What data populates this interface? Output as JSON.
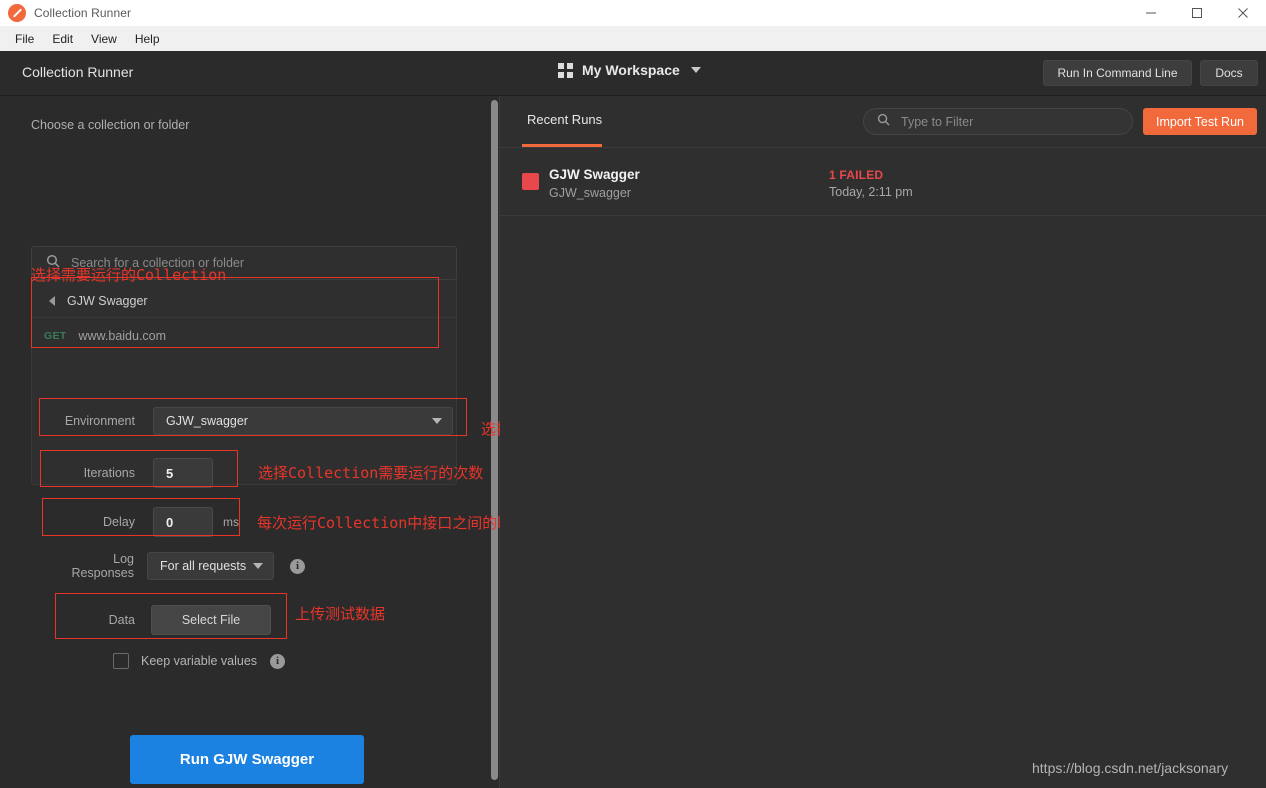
{
  "window": {
    "title": "Collection Runner",
    "icon": "postman-icon",
    "controls": {
      "minimize": "minimize-icon",
      "maximize": "maximize-icon",
      "close": "close-icon"
    }
  },
  "menubar": {
    "items": [
      {
        "label": "File"
      },
      {
        "label": "Edit"
      },
      {
        "label": "View"
      },
      {
        "label": "Help"
      }
    ]
  },
  "header": {
    "title": "Collection Runner",
    "workspace": {
      "icon": "grid-icon",
      "name": "My Workspace",
      "caret": "chevron-down-icon"
    },
    "run_in_command_line": "Run In Command Line",
    "docs": "Docs"
  },
  "left_panel": {
    "heading": "Choose a collection or folder",
    "search": {
      "icon": "search-icon",
      "placeholder": "Search for a collection or folder"
    },
    "tree": {
      "folder": {
        "expand_icon": "triangle-left-icon",
        "name": "GJW Swagger"
      },
      "request": {
        "method": "GET",
        "url": "www.baidu.com"
      }
    },
    "form": {
      "environment": {
        "label": "Environment",
        "value": "GJW_swagger",
        "caret": "chevron-down-icon"
      },
      "iterations": {
        "label": "Iterations",
        "value": "5"
      },
      "delay": {
        "label": "Delay",
        "value": "0",
        "unit": "ms"
      },
      "log_responses": {
        "label": "Log Responses",
        "value": "For all requests",
        "caret": "chevron-down-icon",
        "info": "info-icon"
      },
      "data": {
        "label": "Data",
        "button": "Select File"
      },
      "keep_variable_values": {
        "label": "Keep variable values",
        "checked": false,
        "info": "info-icon"
      }
    },
    "run_button": "Run GJW Swagger"
  },
  "right_panel": {
    "tab": "Recent Runs",
    "filter": {
      "icon": "search-icon",
      "placeholder": "Type to Filter"
    },
    "import_button": "Import Test Run",
    "runs": [
      {
        "status": "failed",
        "name": "GJW Swagger",
        "environment": "GJW_swagger",
        "result": "1 FAILED",
        "time": "Today, 2:11 pm"
      }
    ]
  },
  "annotations": [
    {
      "text": "选择需要运行的Collection"
    },
    {
      "text": "选择Collection的运行环境"
    },
    {
      "text": "选择Collection需要运行的次数"
    },
    {
      "text": "每次运行Collection中接口之间的时间间隔"
    },
    {
      "text": "上传测试数据"
    }
  ],
  "watermark": "https://blog.csdn.net/jacksonary",
  "colors": {
    "accent_orange": "#f2693c",
    "run_blue": "#1b82e2",
    "fail_red": "#e8474b",
    "annotation_red": "#e8352a",
    "method_get_green": "#3a7a5c",
    "app_bg": "#2b2b2b"
  }
}
